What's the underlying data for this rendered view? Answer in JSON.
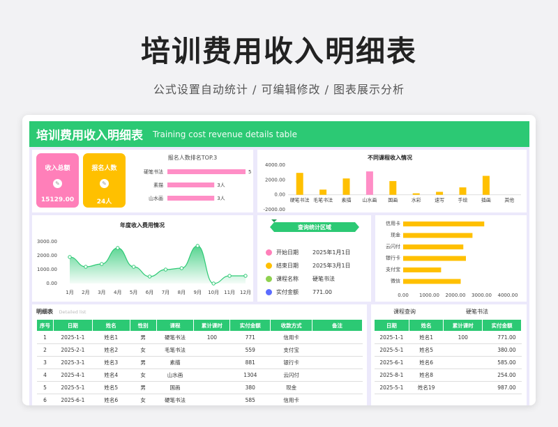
{
  "hero": {
    "title": "培训费用收入明细表",
    "subtitle": "公式设置自动统计 /  可编辑修改  /  图表展示分析"
  },
  "banner": {
    "title": "培训费用收入明细表",
    "title_en": "Training cost revenue details table"
  },
  "kpis": [
    {
      "label": "收入总额",
      "value": "15129.00",
      "color": "#ff7fb9"
    },
    {
      "label": "报名人数",
      "value": "24人",
      "color": "#ffc000"
    }
  ],
  "top3": {
    "title": "报名人数排名TOP.3",
    "items": [
      {
        "name": "硬笔书法",
        "value": 5,
        "label": "5人"
      },
      {
        "name": "素描",
        "value": 3,
        "label": "3人"
      },
      {
        "name": "山水画",
        "value": 3,
        "label": "3人"
      }
    ],
    "max": 5
  },
  "chart_data": [
    {
      "type": "bar",
      "title": "不同课程收入情况",
      "categories": [
        "硬笔书法",
        "毛笔书法",
        "素描",
        "山水画",
        "国画",
        "水彩",
        "速写",
        "手绘",
        "插画",
        "其他"
      ],
      "values": [
        2950,
        700,
        2200,
        3150,
        1850,
        200,
        400,
        1000,
        2550,
        0
      ],
      "highlight_index": 3,
      "yticks": [
        "4000.00",
        "2000.00",
        "0.00",
        "-2000.00"
      ],
      "ylim": [
        -2000,
        4000
      ]
    },
    {
      "type": "area",
      "title": "年度收入费用情况",
      "categories": [
        "1月",
        "2月",
        "3月",
        "4月",
        "5月",
        "6月",
        "7月",
        "8月",
        "9月",
        "10月",
        "11月",
        "12月"
      ],
      "values": [
        1900,
        1200,
        1400,
        2550,
        1200,
        500,
        1000,
        1100,
        2700,
        0,
        550,
        550
      ],
      "yticks": [
        "3000.00",
        "2000.00",
        "1000.00",
        "0.00"
      ],
      "ylim": [
        0,
        3000
      ]
    },
    {
      "type": "bar",
      "orientation": "horizontal",
      "categories": [
        "信用卡",
        "现金",
        "云闪付",
        "银行卡",
        "支付宝",
        "微信"
      ],
      "values": [
        3100,
        2650,
        2300,
        2400,
        1450,
        2200
      ],
      "xticks": [
        "0.00",
        "1000.00",
        "2000.00",
        "3000.00",
        "4000.00"
      ],
      "xlim": [
        0,
        4000
      ]
    }
  ],
  "query": {
    "title": "查询统计区域",
    "rows": [
      {
        "k": "开始日期",
        "v": "2025年1月1日",
        "c": "#ff7fb9"
      },
      {
        "k": "结束日期",
        "v": "2025年3月1日",
        "c": "#ffc000"
      },
      {
        "k": "课程名称",
        "v": "硬笔书法",
        "c": "#8fd14f"
      },
      {
        "k": "实付金额",
        "v": "771.00",
        "c": "#5b6cff"
      }
    ]
  },
  "detail": {
    "label": "明细表",
    "label_en": "Detailed list",
    "headers": [
      "序号",
      "日期",
      "姓名",
      "性别",
      "课程",
      "累计课时",
      "实付金额",
      "收款方式",
      "备注"
    ],
    "rows": [
      [
        "1",
        "2025-1-1",
        "姓名1",
        "男",
        "硬笔书法",
        "100",
        "771",
        "信用卡",
        ""
      ],
      [
        "2",
        "2025-2-1",
        "姓名2",
        "女",
        "毛笔书法",
        "",
        "559",
        "支付宝",
        ""
      ],
      [
        "3",
        "2025-3-1",
        "姓名3",
        "男",
        "素描",
        "",
        "881",
        "银行卡",
        ""
      ],
      [
        "4",
        "2025-4-1",
        "姓名4",
        "女",
        "山水画",
        "",
        "1304",
        "云闪付",
        ""
      ],
      [
        "5",
        "2025-5-1",
        "姓名5",
        "男",
        "国画",
        "",
        "380",
        "现金",
        ""
      ],
      [
        "6",
        "2025-6-1",
        "姓名6",
        "女",
        "硬笔书法",
        "",
        "585",
        "信用卡",
        ""
      ]
    ]
  },
  "course_query": {
    "label": "课程查询",
    "value": "硬笔书法",
    "headers": [
      "日期",
      "姓名",
      "累计课时",
      "实付金额"
    ],
    "rows": [
      [
        "2025-1-1",
        "姓名1",
        "100",
        "771.00"
      ],
      [
        "2025-5-1",
        "姓名5",
        "",
        "380.00"
      ],
      [
        "2025-6-1",
        "姓名6",
        "",
        "585.00"
      ],
      [
        "2025-8-1",
        "姓名8",
        "",
        "254.00"
      ],
      [
        "2025-5-1",
        "姓名19",
        "",
        "987.00"
      ]
    ]
  }
}
